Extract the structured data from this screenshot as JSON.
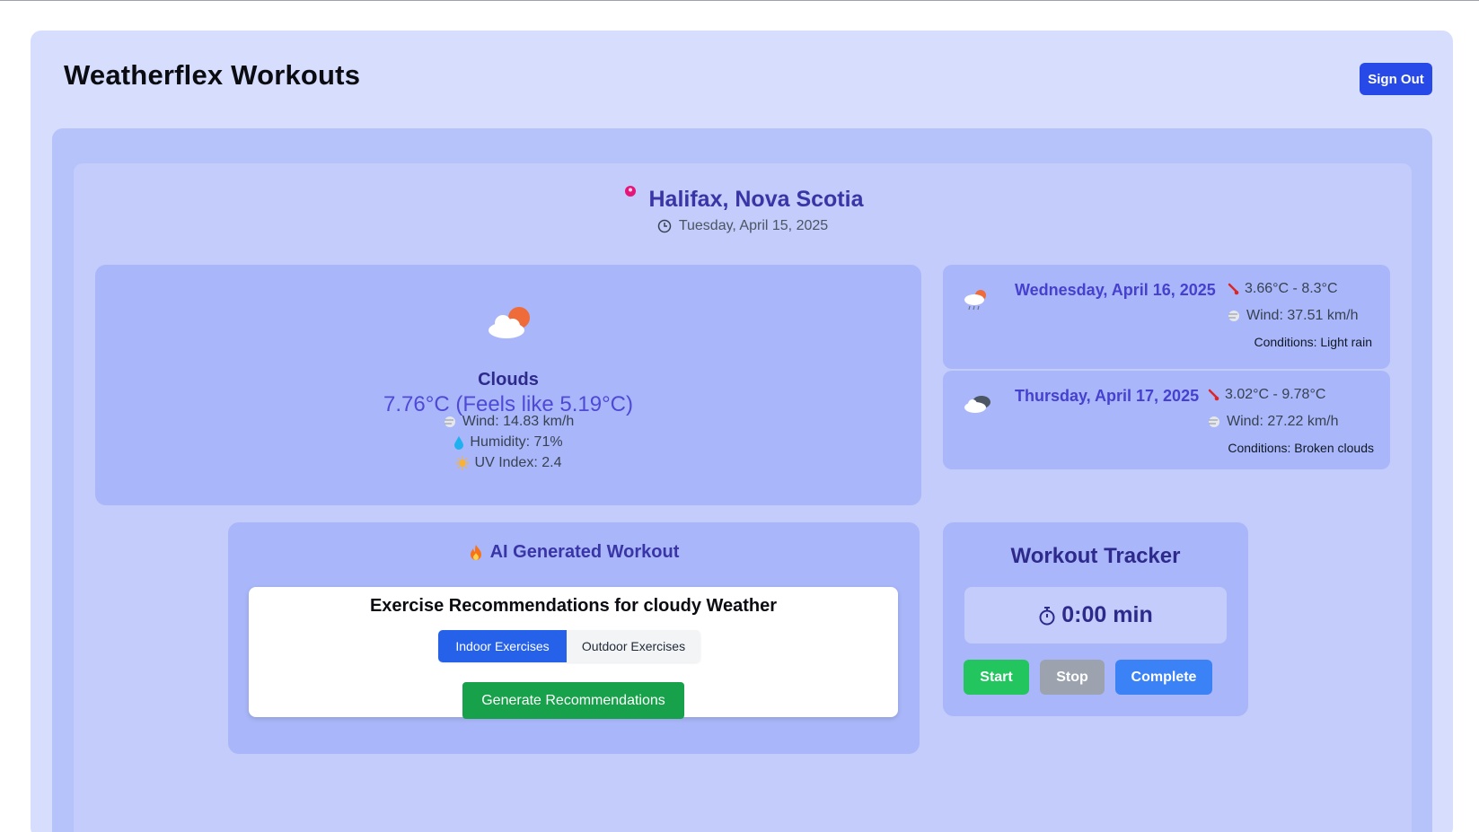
{
  "app": {
    "title": "Weatherflex Workouts",
    "signout_label": "Sign Out"
  },
  "location": {
    "city": "Halifax, Nova Scotia",
    "date": "Tuesday, April 15, 2025",
    "pin_icon": "map-pin-icon",
    "clock_icon": "clock-icon"
  },
  "current": {
    "icon": "sun-behind-cloud-icon",
    "condition": "Clouds",
    "temperature": "7.76°C (Feels like 5.19°C)",
    "wind": "Wind: 14.83 km/h",
    "humidity": "Humidity: 71%",
    "uv": "UV Index: 2.4"
  },
  "forecast": [
    {
      "icon": "cloud-rain-sun-icon",
      "date": "Wednesday, April 16, 2025",
      "temp_range": "3.66°C - 8.3°C",
      "wind": "Wind: 37.51 km/h",
      "conditions": "Conditions: Light rain"
    },
    {
      "icon": "broken-clouds-icon",
      "date": "Thursday, April 17, 2025",
      "temp_range": "3.02°C - 9.78°C",
      "wind": "Wind: 27.22 km/h",
      "conditions": "Conditions: Broken clouds"
    }
  ],
  "ai_workout": {
    "title": "AI Generated Workout",
    "rec_title": "Exercise Recommendations for cloudy Weather",
    "tab_indoor": "Indoor Exercises",
    "tab_outdoor": "Outdoor Exercises",
    "active_tab": "Indoor Exercises",
    "generate_label": "Generate Recommendations"
  },
  "tracker": {
    "title": "Workout Tracker",
    "time": "0:00 min",
    "start_label": "Start",
    "stop_label": "Stop",
    "complete_label": "Complete"
  },
  "colors": {
    "accent": "#2749e8",
    "start": "#22c55e",
    "stop": "#9ca3af",
    "complete": "#3b82f6",
    "generate": "#17a14a"
  }
}
